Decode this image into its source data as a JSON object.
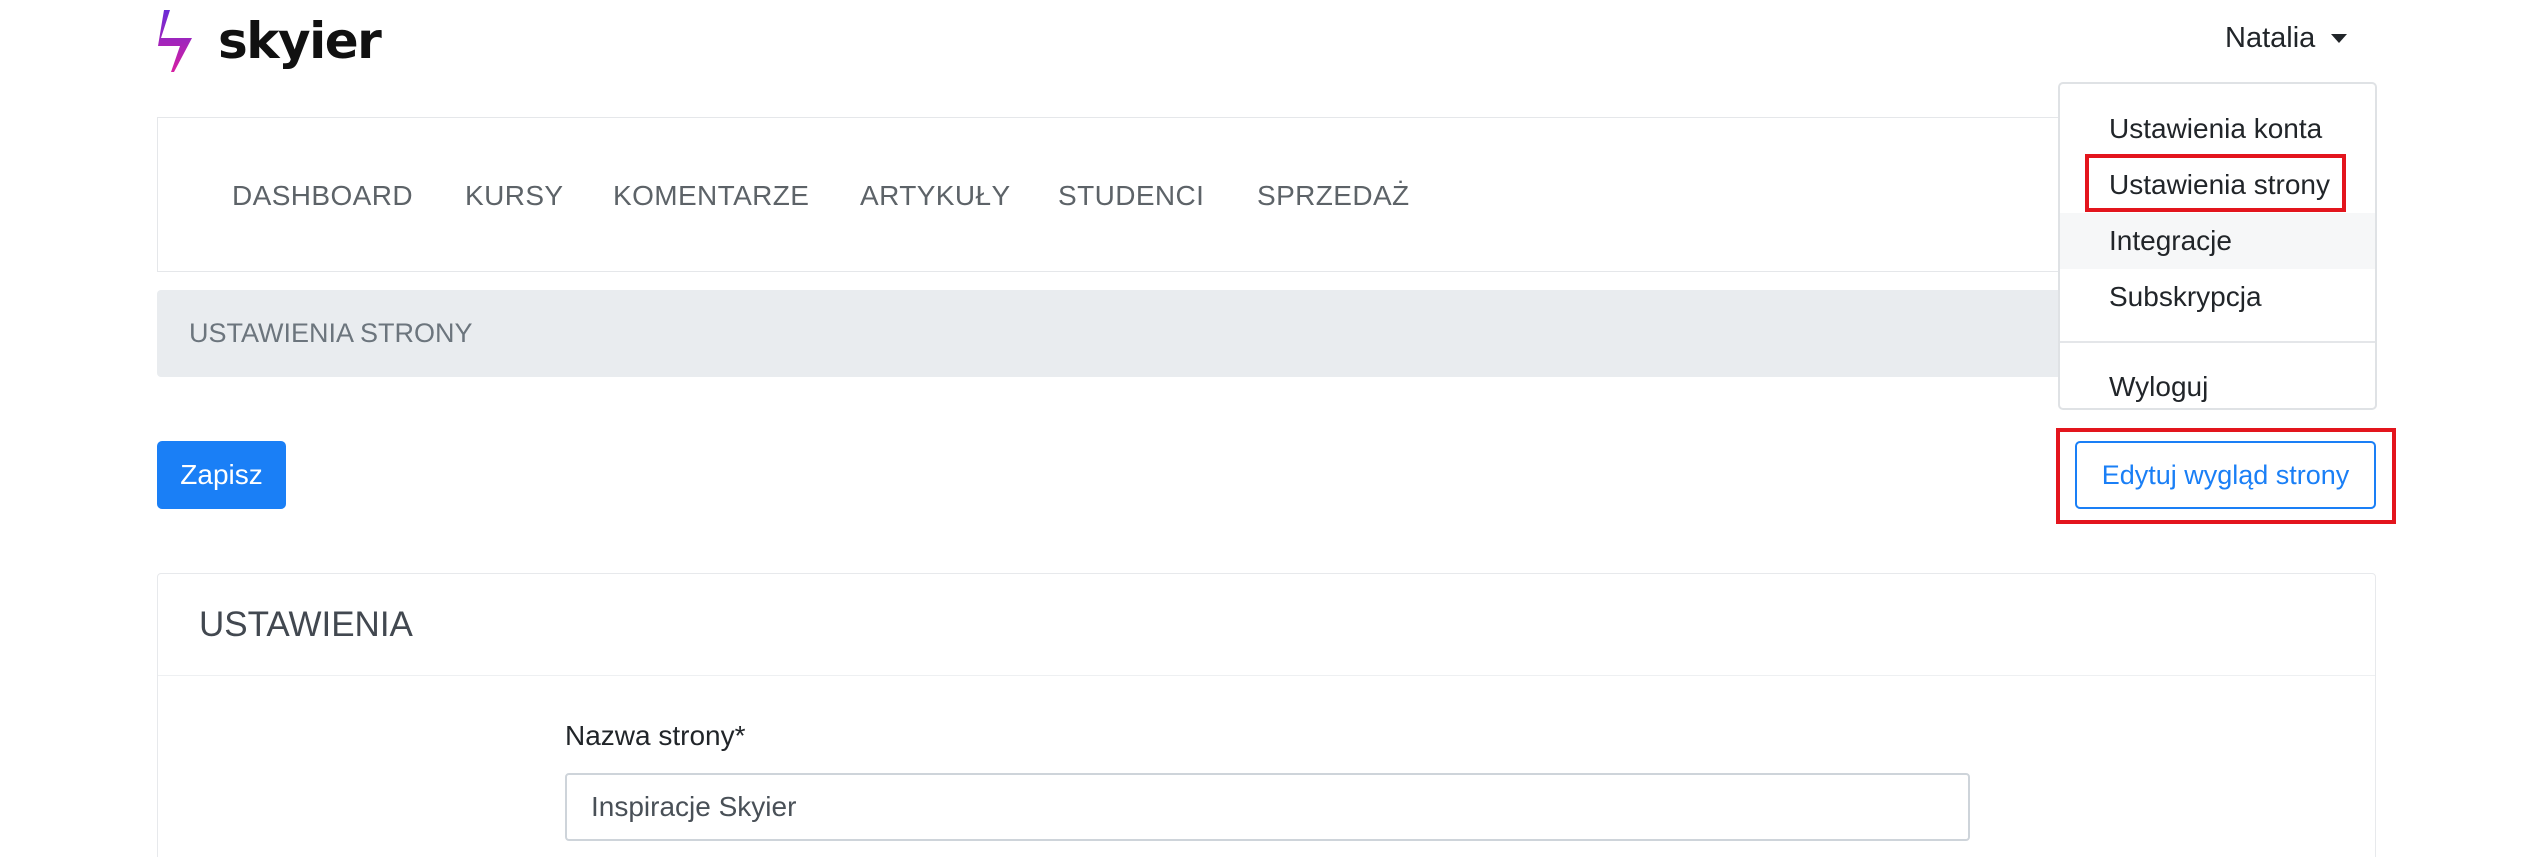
{
  "brand": {
    "name": "skyier",
    "colors": {
      "bolt_top": "#6b2bd6",
      "bolt_bottom": "#d61fa2"
    }
  },
  "user_menu": {
    "name": "Natalia",
    "items": [
      "Ustawienia konta",
      "Ustawienia strony",
      "Integracje",
      "Subskrypcja"
    ],
    "logout": "Wyloguj"
  },
  "nav": {
    "items": [
      "DASHBOARD",
      "KURSY",
      "KOMENTARZE",
      "ARTYKUŁY",
      "STUDENCI",
      "SPRZEDAŻ"
    ]
  },
  "breadcrumb": "USTAWIENIA STRONY",
  "actions": {
    "save": "Zapisz",
    "edit_appearance": "Edytuj wygląd strony"
  },
  "settings": {
    "title": "USTAWIENIA",
    "site_name_label": "Nazwa strony*",
    "site_name_value": "Inspiracje Skyier"
  },
  "colors": {
    "primary": "#1a7ff6",
    "highlight": "#e3151d"
  }
}
